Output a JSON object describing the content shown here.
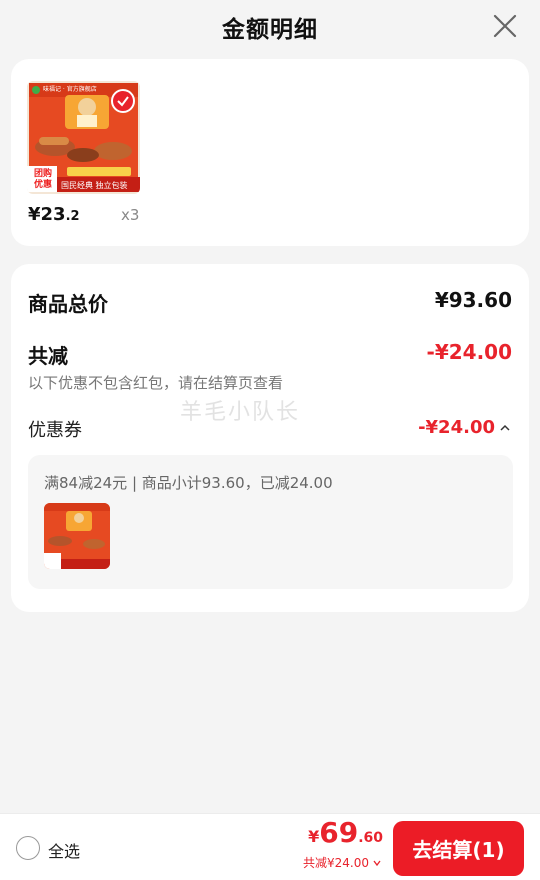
{
  "header": {
    "title": "金额明细"
  },
  "product": {
    "image_label_brand": "味福记 · 官方旗舰店",
    "image_label_tag": "团购优惠",
    "image_label_slogan": "国民经典 独立包装",
    "price_main": "¥23",
    "price_cents": ".2",
    "quantity": "x3"
  },
  "summary": {
    "total_label": "商品总价",
    "total_value": "¥93.60",
    "discount_label": "共减",
    "discount_value": "-¥24.00",
    "note": "以下优惠不包含红包，请在结算页查看",
    "coupon_label": "优惠券",
    "coupon_value": "-¥24.00",
    "coupon_desc": "满84减24元 | 商品小计93.60，已减24.00"
  },
  "watermark": "羊毛小队长",
  "footer": {
    "select_all": "全选",
    "total_yen": "¥",
    "total_int": "69",
    "total_cents": ".60",
    "total_discount": "共减¥24.00",
    "checkout_label": "去结算(1)"
  },
  "colors": {
    "accent": "#ec1c26",
    "discount": "#e8232c"
  }
}
